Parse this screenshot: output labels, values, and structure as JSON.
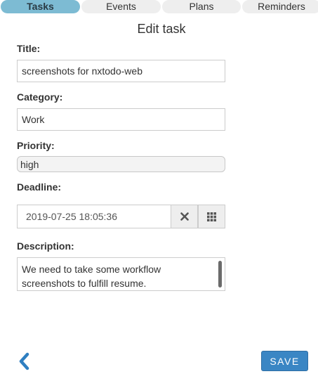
{
  "tabs": [
    {
      "label": "Tasks",
      "active": true
    },
    {
      "label": "Events",
      "active": false
    },
    {
      "label": "Plans",
      "active": false
    },
    {
      "label": "Reminders",
      "active": false
    }
  ],
  "page_title": "Edit task",
  "form": {
    "title_label": "Title:",
    "title_value": "screenshots for nxtodo-web",
    "category_label": "Category:",
    "category_value": "Work",
    "priority_label": "Priority:",
    "priority_value": "high",
    "deadline_label": "Deadline:",
    "deadline_value": "2019-07-25 18:05:36",
    "description_label": "Description:",
    "description_value": "We need to take some workflow screenshots to fulfill resume."
  },
  "icons": {
    "clear": "close-icon",
    "calendar": "calendar-grid-icon",
    "back": "chevron-left-icon"
  },
  "buttons": {
    "save_label": "SAVE"
  },
  "colors": {
    "active_tab": "#7dbbd3",
    "primary_button": "#3a86c4",
    "back_icon": "#2f7fc1"
  }
}
